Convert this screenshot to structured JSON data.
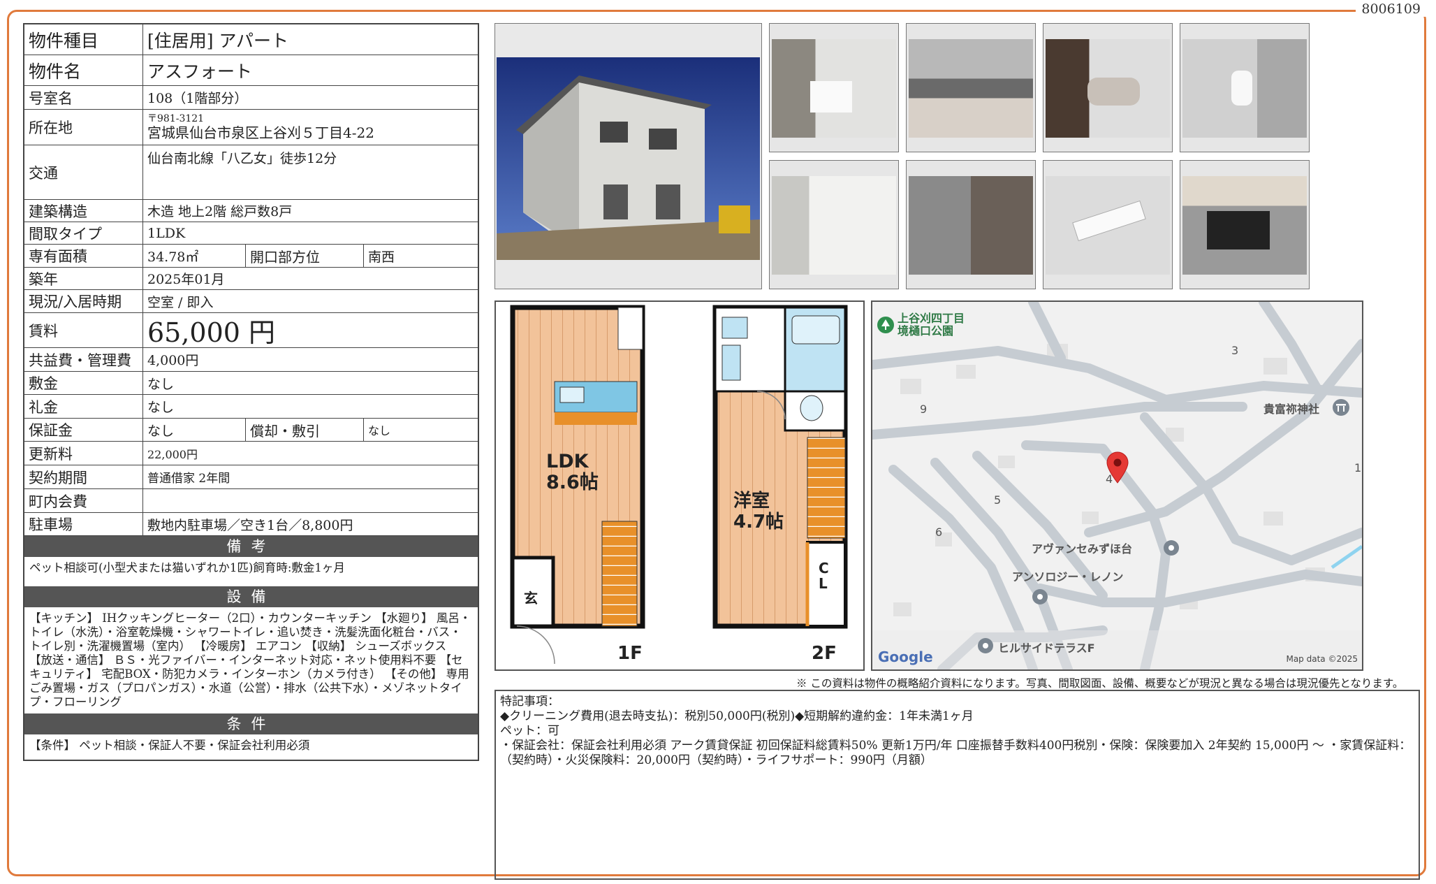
{
  "doc_id": "8006109",
  "spec": {
    "type_label": "物件種目",
    "type_value": "[住居用] アパート",
    "name_label": "物件名",
    "name_value": "アスフォート",
    "room_label": "号室名",
    "room_value": "108（1階部分）",
    "address_label": "所在地",
    "postal": "〒981-3121",
    "address": "宮城県仙台市泉区上谷刈５丁目4-22",
    "transit_label": "交通",
    "transit_value": "仙台南北線「八乙女」徒歩12分",
    "structure_label": "建築構造",
    "structure_value": "木造 地上2階 総戸数8戸",
    "layout_label": "間取タイプ",
    "layout_value": "1LDK",
    "area_label": "専有面積",
    "area_value": "34.78㎡",
    "direction_label": "開口部方位",
    "direction_value": "南西",
    "built_label": "築年",
    "built_value": "2025年01月",
    "status_label": "現況/入居時期",
    "status_value": "空室 / 即入",
    "rent_label": "賃料",
    "rent_value": "65,000 円",
    "fee_label": "共益費・管理費",
    "fee_value": "4,000円",
    "deposit_label": "敷金",
    "deposit_value": "なし",
    "keymoney_label": "礼金",
    "keymoney_value": "なし",
    "guarantee_label": "保証金",
    "guarantee_value": "なし",
    "amort_label": "償却・敷引",
    "amort_value": "なし",
    "renewal_label": "更新料",
    "renewal_value": "22,000円",
    "contract_label": "契約期間",
    "contract_value": "普通借家 2年間",
    "assoc_label": "町内会費",
    "assoc_value": "",
    "parking_label": "駐車場",
    "parking_value": "敷地内駐車場／空き1台／8,800円"
  },
  "remarks": {
    "head": "備考",
    "text": "ペット相談可(小型犬または猫いずれか1匹)飼育時:敷金1ヶ月"
  },
  "facilities": {
    "head": "設備",
    "text": "【キッチン】 IHクッキングヒーター（2口）・カウンターキッチン 【水廻り】 風呂・トイレ（水洗）・浴室乾燥機・シャワートイレ・追い焚き・洗髪洗面化粧台・バス・トイレ別・洗濯機置場（室内） 【冷暖房】 エアコン 【収納】 シューズボックス 【放送・通信】 ＢＳ・光ファイバー・インターネット対応・ネット使用料不要 【セキュリティ】 宅配BOX・防犯カメラ・インターホン（カメラ付き） 【その他】 専用ごみ置場・ガス（プロパンガス）・水道（公営）・排水（公共下水）・メゾネットタイプ・フローリング"
  },
  "conditions": {
    "head": "条件",
    "text": "【条件】 ペット相談・保証人不要・保証会社利用必須"
  },
  "floorplan": {
    "ldk": "LDK",
    "ldk_size": "8.6帖",
    "western": "洋室",
    "western_size": "4.7帖",
    "entrance": "玄",
    "closet_c": "C",
    "closet_l": "L",
    "floor1": "1F",
    "floor2": "2F"
  },
  "map": {
    "park": "上谷刈四丁目",
    "park2": "境樋口公園",
    "shrine": "貴富祢神社",
    "place1": "アヴァンセみずほ台",
    "place2": "アンソロジー・レノン",
    "place3": "ヒルサイドテラスF",
    "block3": "3",
    "block9": "9",
    "block1": "1",
    "block4": "4",
    "block5": "5",
    "block6": "6",
    "google": "Google",
    "mapdata": "Map data ©2025"
  },
  "disclaimer": "※ この資料は物件の概略紹介資料になります。写真、間取図面、設備、概要などが現況と異なる場合は現況優先となります。",
  "special": {
    "title": "特記事項：",
    "line1": "◆クリーニング費用(退去時支払)：税別50,000円(税別)◆短期解約違約金：1年未満1ヶ月",
    "line2": "ペット：可",
    "line3": "・保証会社：保証会社利用必須 アーク賃貸保証 初回保証料総賃料50% 更新1万円/年 口座振替手数料400円税別・保険：保険要加入 2年契約 15,000円 〜 ・家賃保証料：（契約時）・火災保険料：20,000円（契約時）・ライフサポート：990円（月額）"
  },
  "colors": {
    "frame": "#e07a3c",
    "section": "#555555",
    "flooring": "#f2c39a",
    "stairs": "#e8902a"
  }
}
